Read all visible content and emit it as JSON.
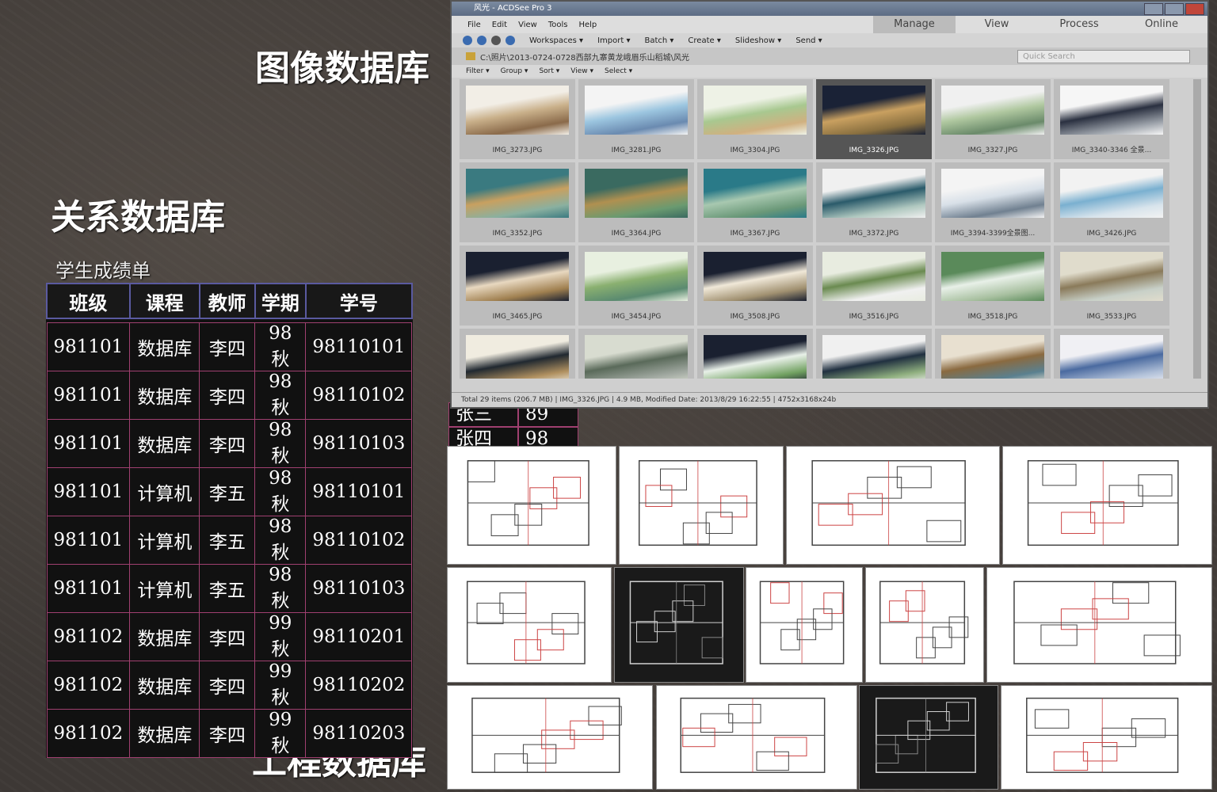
{
  "headings": {
    "image_db": "图像数据库",
    "relational_db": "关系数据库",
    "engineering_db": "工程数据库",
    "table_title": "学生成绩单"
  },
  "table": {
    "headers": [
      "班级",
      "课程",
      "教师",
      "学期",
      "学号"
    ],
    "rows": [
      [
        "981101",
        "数据库",
        "李四",
        "98秋",
        "98110101"
      ],
      [
        "981101",
        "数据库",
        "李四",
        "98秋",
        "98110102"
      ],
      [
        "981101",
        "数据库",
        "李四",
        "98秋",
        "98110103"
      ],
      [
        "981101",
        "计算机",
        "李五",
        "98秋",
        "98110101"
      ],
      [
        "981101",
        "计算机",
        "李五",
        "98秋",
        "98110102"
      ],
      [
        "981101",
        "计算机",
        "李五",
        "98秋",
        "98110103"
      ],
      [
        "981102",
        "数据库",
        "李四",
        "99秋",
        "98110201"
      ],
      [
        "981102",
        "数据库",
        "李四",
        "99秋",
        "98110202"
      ],
      [
        "981102",
        "数据库",
        "李四",
        "99秋",
        "98110203"
      ]
    ],
    "peek": [
      [
        "张三",
        "89"
      ],
      [
        "张四",
        "98"
      ]
    ]
  },
  "acdsee": {
    "title": "风光 - ACDSee Pro 3",
    "menu": [
      "File",
      "Edit",
      "View",
      "Tools",
      "Help"
    ],
    "modes": [
      "Manage",
      "View",
      "Process",
      "Online"
    ],
    "active_mode": "Manage",
    "toolbar": [
      "Workspaces ▾",
      "Import ▾",
      "Batch ▾",
      "Create ▾",
      "Slideshow ▾",
      "Send ▾"
    ],
    "path": "C:\\照片\\2013-0724-0728西部九寨黄龙峨眉乐山稻城\\风光",
    "quick_search": "Quick Search",
    "filters": [
      "Filter ▾",
      "Group ▾",
      "Sort ▾",
      "View ▾",
      "Select ▾"
    ],
    "thumbnails": [
      "IMG_3273.JPG",
      "IMG_3281.JPG",
      "IMG_3304.JPG",
      "IMG_3326.JPG",
      "IMG_3327.JPG",
      "IMG_3340-3346 全景...",
      "IMG_3352.JPG",
      "IMG_3364.JPG",
      "IMG_3367.JPG",
      "IMG_3372.JPG",
      "IMG_3394-3399全景图...",
      "IMG_3426.JPG",
      "IMG_3465.JPG",
      "IMG_3454.JPG",
      "IMG_3508.JPG",
      "IMG_3516.JPG",
      "IMG_3518.JPG",
      "IMG_3533.JPG",
      "",
      "",
      "",
      "",
      "",
      ""
    ],
    "selected_index": 3,
    "status": "Total 29 items (206.7 MB)  |  IMG_3326.JPG  |  4.9 MB, Modified Date: 2013/8/29 16:22:55  |  4752x3168x24b"
  }
}
